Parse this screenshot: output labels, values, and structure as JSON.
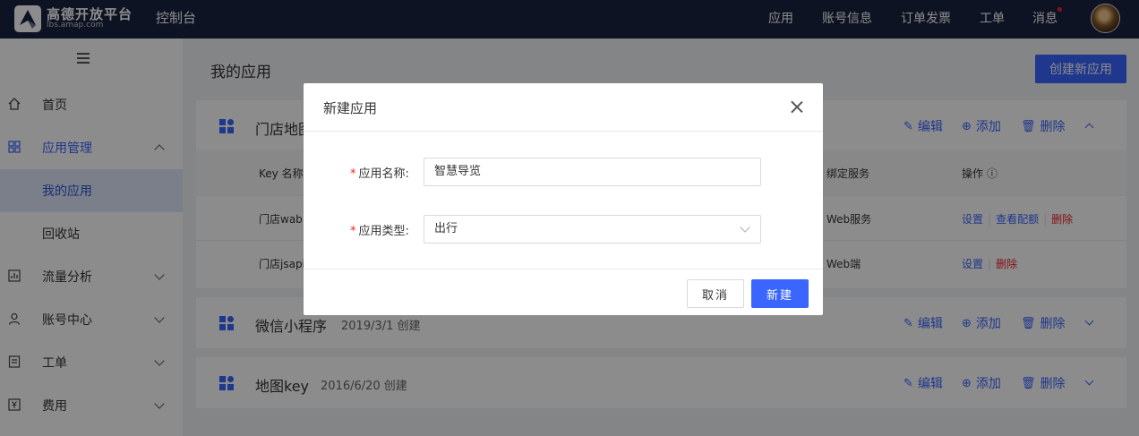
{
  "topnav": {
    "logo_name": "高德开放平台",
    "logo_url": "lbs.amap.com",
    "console_title": "控制台",
    "items": [
      "应用",
      "账号信息",
      "订单发票",
      "工单",
      "消息"
    ]
  },
  "sidebar": {
    "items": [
      {
        "label": "首页",
        "icon": "home-icon"
      },
      {
        "label": "应用管理",
        "icon": "grid-icon"
      },
      {
        "label": "我的应用"
      },
      {
        "label": "回收站"
      },
      {
        "label": "流量分析",
        "icon": "chart-icon"
      },
      {
        "label": "账号中心",
        "icon": "user-icon"
      },
      {
        "label": "工单",
        "icon": "ticket-icon"
      },
      {
        "label": "费用",
        "icon": "fee-icon"
      }
    ]
  },
  "main": {
    "title": "我的应用",
    "create_button": "创建新应用",
    "actions": {
      "edit": "编辑",
      "add": "添加",
      "delete": "删除"
    },
    "cards": [
      {
        "name": "门店地图",
        "table": {
          "headers": [
            "Key 名称",
            "绑定服务",
            "操作"
          ],
          "rows": [
            {
              "name": "门店wab",
              "service": "Web服务",
              "ops": [
                "设置",
                "查看配额",
                "删除"
              ]
            },
            {
              "name": "门店jsapi",
              "service": "Web端",
              "ops": [
                "设置",
                "删除"
              ]
            }
          ]
        }
      },
      {
        "name": "微信小程序",
        "date": "2019/3/1 创建"
      },
      {
        "name": "地图key",
        "date": "2016/6/20 创建"
      }
    ]
  },
  "modal": {
    "title": "新建应用",
    "name_label": "应用名称:",
    "name_value": "智慧导览",
    "type_label": "应用类型:",
    "type_value": "出行",
    "required_mark": "*",
    "cancel": "取消",
    "confirm": "新建"
  },
  "colors": {
    "accent": "#3a65ff",
    "nav_bg": "#1b2340",
    "danger": "#f5222d"
  }
}
